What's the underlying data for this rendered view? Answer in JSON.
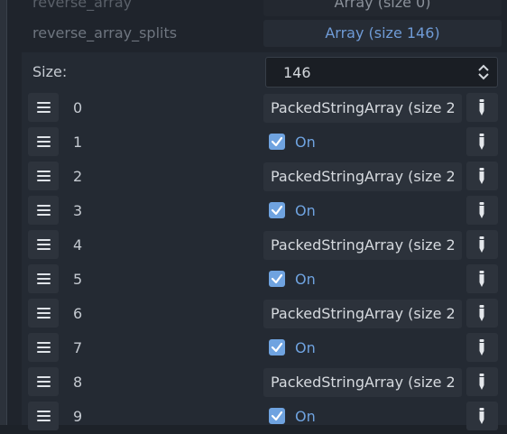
{
  "properties": [
    {
      "name": "reverse_array",
      "value": "Array (size 0)"
    },
    {
      "name": "reverse_array_splits",
      "value": "Array (size 146)"
    }
  ],
  "array_editor": {
    "size_label": "Size:",
    "size_value": "146",
    "elements": [
      {
        "index": "0",
        "kind": "text",
        "value": "PackedStringArray (size 2"
      },
      {
        "index": "1",
        "kind": "bool",
        "value": "On"
      },
      {
        "index": "2",
        "kind": "text",
        "value": "PackedStringArray (size 2"
      },
      {
        "index": "3",
        "kind": "bool",
        "value": "On"
      },
      {
        "index": "4",
        "kind": "text",
        "value": "PackedStringArray (size 2"
      },
      {
        "index": "5",
        "kind": "bool",
        "value": "On"
      },
      {
        "index": "6",
        "kind": "text",
        "value": "PackedStringArray (size 2"
      },
      {
        "index": "7",
        "kind": "bool",
        "value": "On"
      },
      {
        "index": "8",
        "kind": "text",
        "value": "PackedStringArray (size 2"
      },
      {
        "index": "9",
        "kind": "bool",
        "value": "On"
      }
    ]
  },
  "icons": {
    "drag_handle": "drag-handle-icon",
    "type_selector": "pencil-icon",
    "checkbox": "check-icon",
    "spinner": "spinner-arrows-icon"
  },
  "colors": {
    "accent": "#6fa3e0",
    "background": "#1d2229"
  }
}
